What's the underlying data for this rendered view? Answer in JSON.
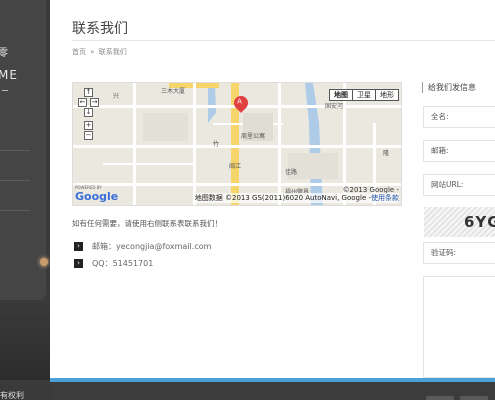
{
  "sidebar": {
    "logo_fragment": "零",
    "brand_fragment": "ME",
    "footer_text": "有权利"
  },
  "page": {
    "title": "联系我们",
    "breadcrumb": [
      "首页",
      "»",
      "联系我们"
    ]
  },
  "map": {
    "type_buttons": [
      "地图",
      "卫星",
      "地形"
    ],
    "active_type": "地图",
    "marker_letter": "A",
    "copyright": "©2013 Google -",
    "attribution": "地图数据 ©2013 GS(2011)6020 AutoNavi, Google -",
    "terms_link": "使用条款",
    "logo": "Google",
    "powered_by": "POWERED BY",
    "labels": [
      "三木大厦",
      "周里公寓",
      "国安河",
      "佳路",
      "兴",
      "竹",
      "福州警界",
      "闽江",
      "隆"
    ],
    "controls": [
      "↑",
      "←",
      "→",
      "↓",
      "+",
      "−"
    ]
  },
  "contact": {
    "intro": "如有任何需要，请使用右侧联系表联系我们！",
    "rows": [
      {
        "icon": "arrow-right-icon",
        "text": "邮箱：yecongjia@foxmail.com"
      },
      {
        "icon": "arrow-right-icon",
        "text": "QQ：51451701"
      }
    ]
  },
  "form": {
    "heading": "给我们发信息",
    "fields": [
      {
        "label": "全名:"
      },
      {
        "label": "邮箱:"
      },
      {
        "label": "网站URL:"
      },
      {
        "label": "验证码:"
      }
    ],
    "captcha_text": "6YG"
  },
  "colors": {
    "sidebar": "#3a3a3a",
    "accent": "#4aa0d8",
    "map_marker": "#e04040"
  }
}
